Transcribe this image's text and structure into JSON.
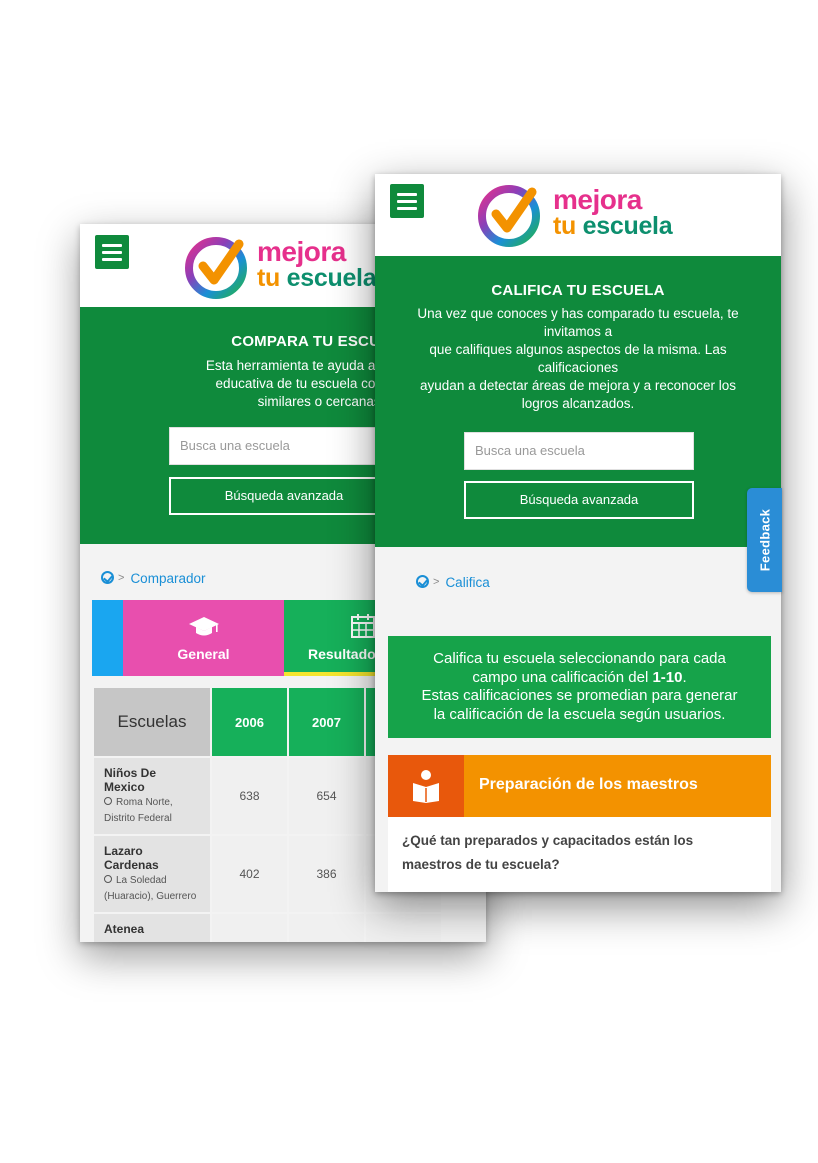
{
  "colors": {
    "brand_green": "#0f8a3c",
    "bright_green": "#16b05a",
    "pink": "#e6308c",
    "orange": "#f39200",
    "dark_orange": "#e8580c",
    "link_blue": "#1a8fd6",
    "feedback_blue": "#2a8dd6"
  },
  "logo": {
    "word1": "mejora",
    "word2a": "tu",
    "word2b": "escuela"
  },
  "back_screen": {
    "hero_title": "COMPARA TU ESCUELA",
    "hero_desc_1": "Esta herramienta te ayuda a comparar",
    "hero_desc_2": "educativa de tu escuela con la de c",
    "hero_desc_3": "similares o cercanas.",
    "search_placeholder": "Busca una escuela",
    "advanced_search_label": "Búsqueda avanzada",
    "breadcrumb": "Comparador",
    "tabs": [
      {
        "label": "General",
        "icon": "graduation-cap-icon"
      },
      {
        "label": "Resultados",
        "icon": "calendar-icon"
      }
    ],
    "table": {
      "header_school": "Escuelas",
      "years": [
        "2006",
        "2007"
      ],
      "rows": [
        {
          "name_1": "Niños De",
          "name_2": "Mexico",
          "loc_1": "Roma Norte,",
          "loc_2": "Distrito Federal",
          "values": [
            "638",
            "654"
          ]
        },
        {
          "name_1": "Lazaro",
          "name_2": "Cardenas",
          "loc_1": "La Soledad",
          "loc_2": "(Huaracio), Guerrero",
          "values": [
            "402",
            "386"
          ]
        },
        {
          "name_1": "Atenea",
          "name_2": "",
          "loc_1": "",
          "loc_2": "",
          "values": [
            "",
            ""
          ]
        }
      ]
    }
  },
  "front_screen": {
    "hero_title": "CALIFICA TU ESCUELA",
    "hero_desc_1": "Una vez que conoces y has comparado tu escuela, te",
    "hero_desc_2": "invitamos a",
    "hero_desc_3": "que califiques algunos aspectos de la misma. Las",
    "hero_desc_4": "calificaciones",
    "hero_desc_5": "ayudan a detectar áreas de mejora y a reconocer los",
    "hero_desc_6": "logros alcanzados.",
    "search_placeholder": "Busca una escuela",
    "advanced_search_label": "Búsqueda avanzada",
    "breadcrumb": "Califica",
    "info_1": "Califica tu escuela seleccionando para cada",
    "info_2a": "campo una calificación del ",
    "info_2b": "1-10",
    "info_2c": ".",
    "info_3": "Estas calificaciones se promedian para generar",
    "info_4": "la calificación de la escuela según usuarios.",
    "section_title": "Preparación de los maestros",
    "section_icon": "reading-person-icon",
    "question_1": "¿Qué tan preparados y capacitados están los",
    "question_2": "maestros de tu escuela?"
  },
  "feedback_label": "Feedback"
}
